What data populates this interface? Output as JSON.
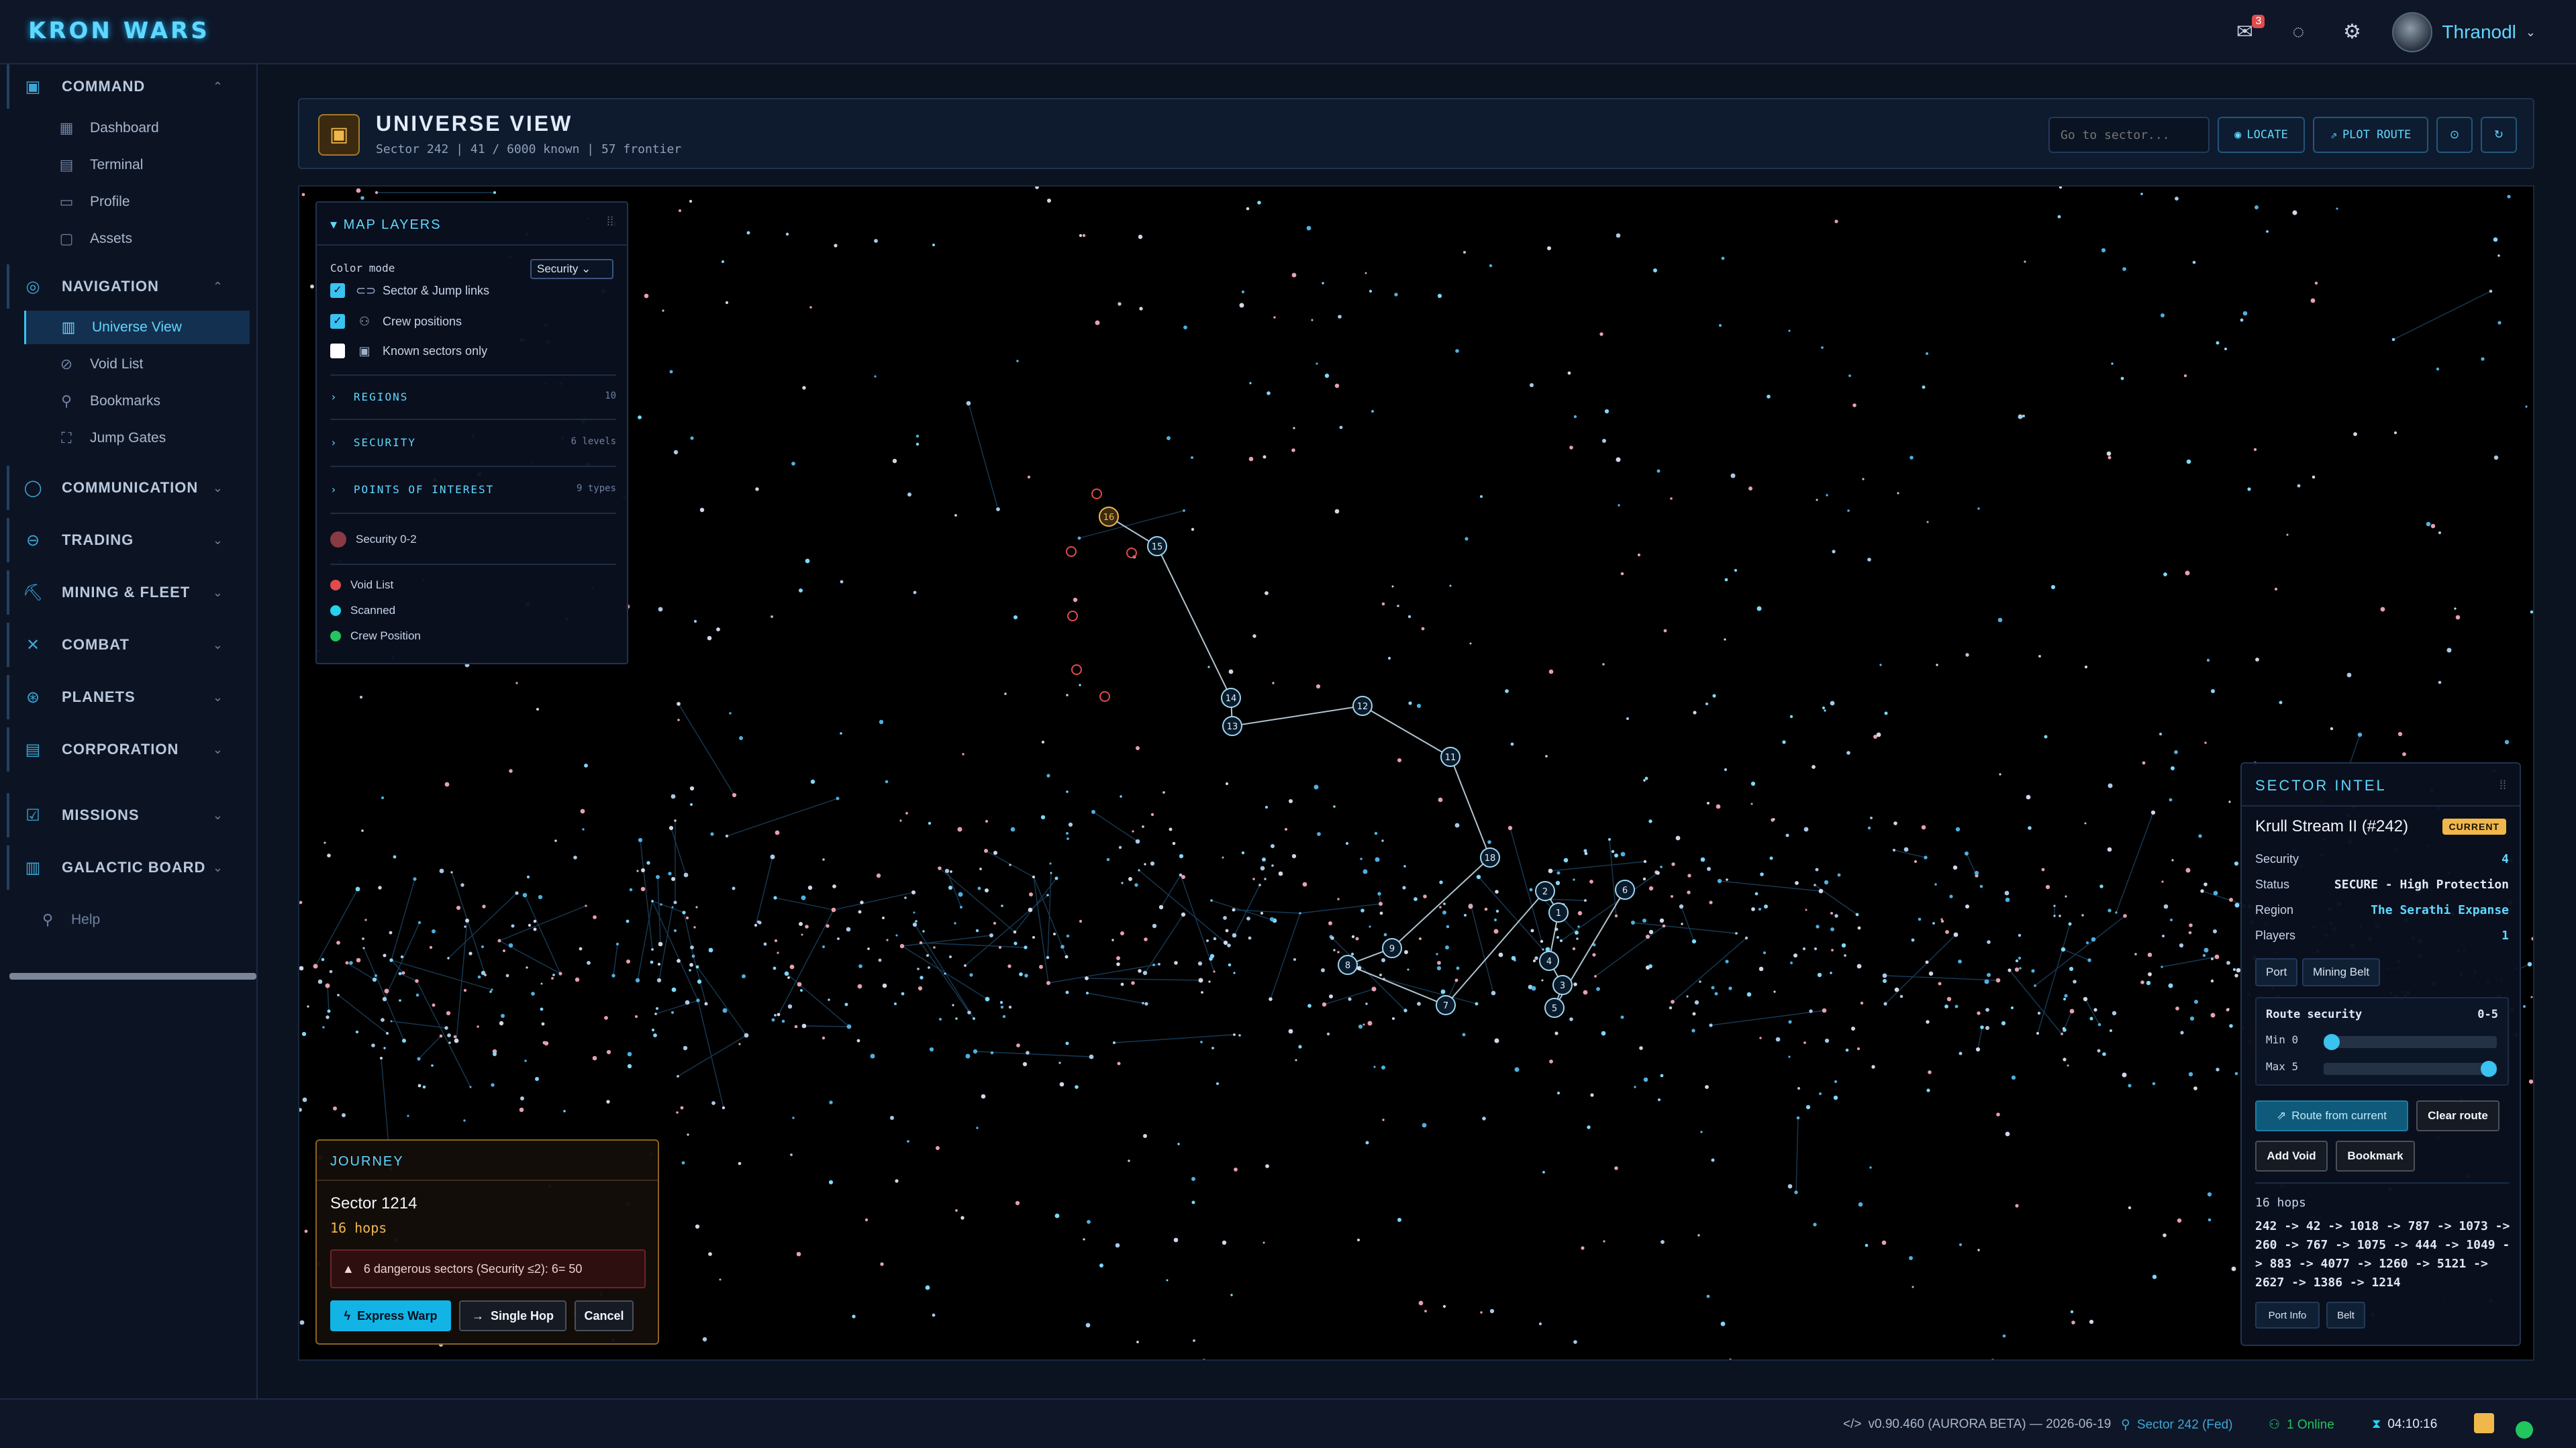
{
  "app": {
    "logo": "KRON WARS"
  },
  "topbar": {
    "mail_badge": "3",
    "user": {
      "name": "Thranodl"
    }
  },
  "sidebar": {
    "sections": [
      {
        "label": "COMMAND",
        "icon": "command-icon",
        "expanded": true,
        "items": [
          {
            "label": "Dashboard",
            "icon": "dashboard-icon"
          },
          {
            "label": "Terminal",
            "icon": "terminal-icon"
          },
          {
            "label": "Profile",
            "icon": "profile-icon"
          },
          {
            "label": "Assets",
            "icon": "assets-icon"
          }
        ]
      },
      {
        "label": "NAVIGATION",
        "icon": "navigation-icon",
        "expanded": true,
        "items": [
          {
            "label": "Universe View",
            "icon": "map-icon",
            "active": true
          },
          {
            "label": "Void List",
            "icon": "void-icon"
          },
          {
            "label": "Bookmarks",
            "icon": "bookmark-icon"
          },
          {
            "label": "Jump Gates",
            "icon": "gate-icon"
          }
        ]
      },
      {
        "label": "COMMUNICATION",
        "icon": "chat-icon"
      },
      {
        "label": "TRADING",
        "icon": "trading-icon"
      },
      {
        "label": "MINING & FLEET",
        "icon": "mining-icon"
      },
      {
        "label": "COMBAT",
        "icon": "combat-icon"
      },
      {
        "label": "PLANETS",
        "icon": "planet-icon"
      },
      {
        "label": "CORPORATION",
        "icon": "corporation-icon"
      },
      {
        "label": "MISSIONS",
        "icon": "missions-icon"
      },
      {
        "label": "GALACTIC BOARD",
        "icon": "board-icon"
      }
    ],
    "help": "Help"
  },
  "view": {
    "title": "UNIVERSE VIEW",
    "subtitle": "Sector 242 | 41 / 6000 known | 57 frontier",
    "goto_placeholder": "Go to sector...",
    "locate_label": "LOCATE",
    "plot_label": "PLOT ROUTE"
  },
  "layers": {
    "title": "MAP LAYERS",
    "color_mode_label": "Color mode",
    "color_mode_value": "Security",
    "toggles": [
      {
        "label": "Sector & Jump links",
        "checked": true
      },
      {
        "label": "Crew positions",
        "checked": true
      },
      {
        "label": "Known sectors only",
        "checked": false
      }
    ],
    "accordions": [
      {
        "label": "REGIONS",
        "count": "10"
      },
      {
        "label": "SECURITY",
        "count": "6 levels"
      },
      {
        "label": "POINTS OF INTEREST",
        "count": "9 types"
      }
    ],
    "security_filter": "Security 0-2",
    "legend": [
      {
        "label": "Void List",
        "color": "#e14b4b"
      },
      {
        "label": "Scanned",
        "color": "#22d3ee"
      },
      {
        "label": "Crew Position",
        "color": "#22c55e"
      }
    ]
  },
  "route_nodes": [
    "16",
    "15",
    "14",
    "13",
    "12",
    "11",
    "18",
    "9",
    "8",
    "7",
    "2",
    "1",
    "4",
    "3",
    "5",
    "6"
  ],
  "journey": {
    "title": "JOURNEY",
    "sector": "Sector 1214",
    "hops": "16 hops",
    "warning": "6 dangerous sectors (Security ≤2): 6= 50",
    "express": "Express Warp",
    "single": "Single Hop",
    "cancel": "Cancel"
  },
  "intel": {
    "title": "SECTOR INTEL",
    "name": "Krull Stream II (#242)",
    "badge": "CURRENT",
    "rows": [
      {
        "label": "Security",
        "value": "4"
      },
      {
        "label": "Status",
        "value": "SECURE - High Protection"
      },
      {
        "label": "Region",
        "value": "The Serathi Expanse"
      },
      {
        "label": "Players",
        "value": "1"
      }
    ],
    "tags": [
      "Port",
      "Mining Belt"
    ],
    "route_security_label": "Route security",
    "route_security_value": "0-5",
    "min_label": "Min 0",
    "max_label": "Max 5",
    "min_value": 0,
    "max_value": 5,
    "route_from_current": "Route from current",
    "clear_route": "Clear route",
    "add_void": "Add Void",
    "bookmark": "Bookmark",
    "hops": "16 hops",
    "path": "242 -> 42 -> 1018 -> 787 -> 1073 -> 260 -> 767 -> 1075 -> 444 -> 1049 -> 883 -> 4077 -> 1260 -> 5121 -> 2627 -> 1386 -> 1214",
    "port_info": "Port Info",
    "belt": "Belt"
  },
  "status": {
    "version": "v0.90.460 (AURORA BETA) — 2026-06-19",
    "sector": "Sector 242 (Fed)",
    "online": "1 Online",
    "clock": "04:10:16"
  }
}
